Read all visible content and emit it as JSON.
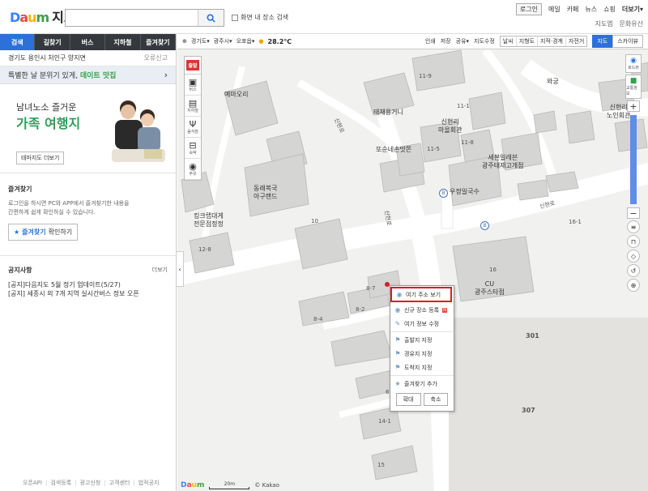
{
  "header": {
    "logo": "Daum",
    "service": "지도",
    "search_placeholder": "",
    "search_scope": "화면 내 장소 검색",
    "topnav": [
      "로그인",
      "메일",
      "카페",
      "뉴스",
      "쇼핑",
      "더보기"
    ],
    "subnav": [
      "지도앱",
      "문화유산"
    ]
  },
  "sidebar": {
    "tabs": [
      "검색",
      "길찾기",
      "버스",
      "지하철",
      "즐겨찾기"
    ],
    "location": "경기도 용인시 처인구 양지면",
    "error_report": "오류신고",
    "promo": {
      "text": "특별한 날 분위기 있게,",
      "highlight": "데이트 맛집"
    },
    "banner": {
      "line1": "남녀노소 즐거운",
      "line2": "가족 여행지",
      "button": "테마지도 더보기"
    },
    "favorites": {
      "title": "즐겨찾기",
      "desc1": "로그인을 하시면 PC와 APP에서 즐겨찾기한 내용을",
      "desc2": "간편하게 쉽게 확인하실 수 있습니다.",
      "button_blue": "즐겨찾기",
      "button_rest": "확인하기"
    },
    "notice": {
      "title": "공지사항",
      "more": "더보기",
      "items": [
        "[공지]다음지도 5월 정기 업데이트(5/27)",
        "[공지] 세종시 외 7개 지역 실시간버스 정보 오픈"
      ]
    },
    "footer": [
      "오픈API",
      "검색등록",
      "광고신청",
      "고객센터",
      "법적공지"
    ]
  },
  "mapbar": {
    "region": [
      "경기도",
      "광주시",
      "오포읍"
    ],
    "temperature": "28.2",
    "temp_unit": "℃",
    "tools": [
      "인쇄",
      "저장",
      "공유",
      "지도수정"
    ],
    "layers": [
      "날씨",
      "지형도",
      "지적·경계",
      "자전거"
    ],
    "map_types": [
      "지도",
      "스카이뷰"
    ]
  },
  "lefttools": [
    "버스",
    "지하철",
    "음식점",
    "숙박",
    "주유"
  ],
  "start_label": "출발",
  "righttools": [
    "로드뷰",
    "교통정보"
  ],
  "map_labels": {
    "pois": [
      "예마오리",
      "태재용거니",
      "신현리\n마을회관",
      "또순네손맛쫀",
      "세븐일레븐\n광주태재고개점",
      "와궁",
      "신현리\n노인회관",
      "동래복국\n아구랜드",
      "킹크랩대게\n전문점정정",
      "우정일국수",
      "CU\n광주스타점"
    ],
    "numbers": [
      "11-9",
      "11-5",
      "11-8",
      "11-1",
      "16-1",
      "16",
      "10",
      "12-8",
      "8-4",
      "8-2",
      "8-7",
      "301",
      "307",
      "14-1",
      "15",
      "6"
    ],
    "roads": [
      "신현로",
      "신현로",
      "신현로"
    ]
  },
  "context_menu": {
    "items": [
      "여기 주소 보기",
      "신규 장소 등록",
      "여기 정보 수정",
      "출발지 지정",
      "경유지 지정",
      "도착지 지정",
      "즐겨찾기 추가"
    ],
    "new_badge": "N",
    "zoom_in": "확대",
    "zoom_out": "축소"
  },
  "map_footer": {
    "logo": "Daum",
    "scale": "20m",
    "copyright": "© Kakao"
  }
}
